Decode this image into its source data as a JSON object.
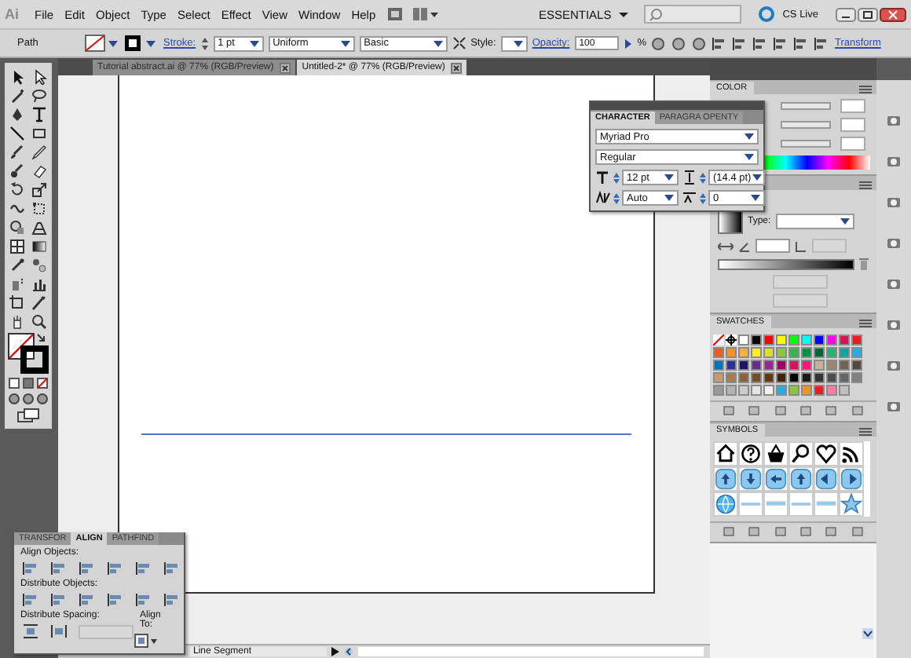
{
  "menu_bar": {
    "logo": "Ai",
    "menus": [
      "File",
      "Edit",
      "Object",
      "Type",
      "Select",
      "Effect",
      "View",
      "Window",
      "Help"
    ],
    "workspace": "ESSENTIALS",
    "cs_live": "CS Live"
  },
  "control_bar": {
    "selection": "Path",
    "stroke_label": "Stroke:",
    "stroke_weight": "1 pt",
    "profile": "Uniform",
    "brush": "Basic",
    "style_label": "Style:",
    "opacity_label": "Opacity:",
    "opacity": "100",
    "percent": "%",
    "transform": "Transform"
  },
  "document_tabs": [
    {
      "label": "Tutorial abstract.ai @ 77% (RGB/Preview)",
      "selected": false
    },
    {
      "label": "Untitled-2* @ 77% (RGB/Preview)",
      "selected": true
    }
  ],
  "character_panel": {
    "tabs": [
      {
        "label": "CHARACTER",
        "selected": true
      },
      {
        "label": "PARAGRA OPENTY",
        "selected": false
      }
    ],
    "font": "Myriad Pro",
    "style": "Regular",
    "size": "12 pt",
    "leading": "(14.4 pt)",
    "kerning": "Auto",
    "tracking": "0"
  },
  "color_panel": {
    "title": "COLOR"
  },
  "gradient_panel": {
    "type_label": "Type:"
  },
  "swatches_panel": {
    "title": "SWATCHES",
    "swatches": [
      {
        "color": "#ffffff"
      },
      {
        "color": "#000000"
      },
      {
        "color": "#ff0000"
      },
      {
        "color": "#ffff00"
      },
      {
        "color": "#00ff00"
      },
      {
        "color": "#00ffff"
      },
      {
        "color": "#0000ff"
      },
      {
        "color": "#ff00ff"
      },
      {
        "color": "#d4145a"
      },
      {
        "color": "#ed1c24"
      },
      {
        "color": "#f15a24"
      },
      {
        "color": "#f7931e"
      },
      {
        "color": "#fbb03b"
      },
      {
        "color": "#fcee21"
      },
      {
        "color": "#d9e021"
      },
      {
        "color": "#8cc63f"
      },
      {
        "color": "#39b54a"
      },
      {
        "color": "#009245"
      },
      {
        "color": "#006837"
      },
      {
        "color": "#22b573"
      },
      {
        "color": "#00a99d"
      },
      {
        "color": "#29abe2"
      },
      {
        "color": "#0071bc"
      },
      {
        "color": "#2e3192"
      },
      {
        "color": "#1b1464"
      },
      {
        "color": "#662d91"
      },
      {
        "color": "#93278f"
      },
      {
        "color": "#9e005d"
      },
      {
        "color": "#d4145a"
      },
      {
        "color": "#ed1e79"
      },
      {
        "color": "#c7b299"
      },
      {
        "color": "#998675"
      },
      {
        "color": "#736357"
      },
      {
        "color": "#534741"
      },
      {
        "color": "#c69c6d"
      },
      {
        "color": "#a67c52"
      },
      {
        "color": "#8c6239"
      },
      {
        "color": "#754c24"
      },
      {
        "color": "#603813"
      },
      {
        "color": "#42210b"
      },
      {
        "color": "#000000"
      },
      {
        "color": "#1a1a1a"
      },
      {
        "color": "#333333"
      },
      {
        "color": "#4d4d4d"
      },
      {
        "color": "#666666"
      },
      {
        "color": "#808080"
      },
      {
        "color": "#999999"
      },
      {
        "color": "#b3b3b3"
      },
      {
        "color": "#cccccc"
      },
      {
        "color": "#e6e6e6"
      },
      {
        "color": "#f2f2f2"
      },
      {
        "color": "#29abe2"
      },
      {
        "color": "#8cc63f"
      },
      {
        "color": "#f7931e"
      },
      {
        "color": "#ed1c24"
      },
      {
        "color": "#ff7bac"
      },
      {
        "color": "#c1c1c1"
      }
    ]
  },
  "symbols_panel": {
    "title": "SYMBOLS"
  },
  "align_panel": {
    "tabs": [
      {
        "label": "TRANSFOR",
        "selected": false
      },
      {
        "label": "ALIGN",
        "selected": true
      },
      {
        "label": "PATHFIND",
        "selected": false
      }
    ],
    "align_objects": "Align Objects:",
    "distribute_objects": "Distribute Objects:",
    "distribute_spacing": "Distribute Spacing:",
    "align_to": "Align To:"
  },
  "status_bar": {
    "tool": "Line Segment"
  }
}
